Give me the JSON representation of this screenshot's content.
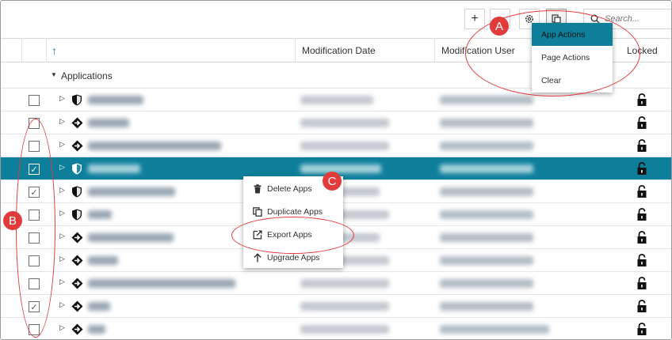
{
  "toolbar": {
    "add_label": "+",
    "settings_icon": "gear-icon",
    "actions_icon": "document-actions-icon",
    "search_placeholder": "Search..."
  },
  "columns": {
    "sort_indicator": "↑",
    "modification_date": "Modification Date",
    "modification_user": "Modification User",
    "locked": "Locked"
  },
  "group": {
    "label": "Applications",
    "expander": "▼"
  },
  "rows": [
    {
      "checked": false,
      "selected": false,
      "icon": "shield-icon"
    },
    {
      "checked": false,
      "selected": false,
      "icon": "diamond-arrow-icon"
    },
    {
      "checked": false,
      "selected": false,
      "icon": "diamond-arrow-icon"
    },
    {
      "checked": true,
      "selected": true,
      "icon": "shield-icon"
    },
    {
      "checked": true,
      "selected": false,
      "icon": "shield-icon"
    },
    {
      "checked": false,
      "selected": false,
      "icon": "shield-icon"
    },
    {
      "checked": false,
      "selected": false,
      "icon": "diamond-arrow-icon"
    },
    {
      "checked": false,
      "selected": false,
      "icon": "diamond-arrow-icon"
    },
    {
      "checked": false,
      "selected": false,
      "icon": "diamond-arrow-icon"
    },
    {
      "checked": true,
      "selected": false,
      "icon": "diamond-arrow-icon"
    },
    {
      "checked": false,
      "selected": false,
      "icon": "diamond-arrow-icon"
    }
  ],
  "actions_menu": {
    "items": [
      "App Actions",
      "Page Actions",
      "Clear"
    ],
    "highlighted": "App Actions"
  },
  "context_menu": {
    "items": [
      {
        "label": "Delete Apps",
        "icon": "trash-icon"
      },
      {
        "label": "Duplicate Apps",
        "icon": "duplicate-icon"
      },
      {
        "label": "Export Apps",
        "icon": "export-icon"
      },
      {
        "label": "Upgrade Apps",
        "icon": "upload-arrow-icon"
      }
    ]
  },
  "annotations": {
    "a": "A",
    "b": "B",
    "c": "C"
  },
  "colors": {
    "accent": "#0e7f9b",
    "annotation": "#e23b3b"
  }
}
